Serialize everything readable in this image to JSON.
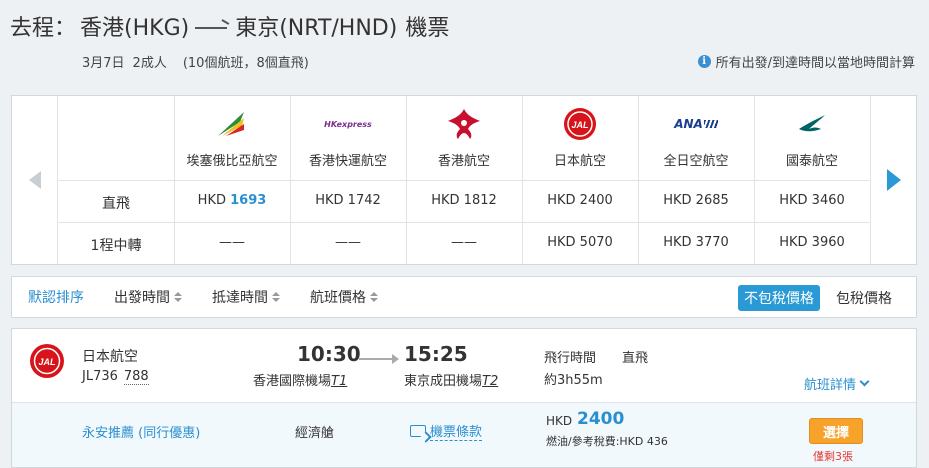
{
  "header": {
    "prefix": "去程",
    "colon": "：",
    "origin": "香港(HKG)",
    "destination": "東京(NRT/HND)",
    "suffix": "機票"
  },
  "subinfo": {
    "date": "3月7日",
    "passengers": "2成人",
    "summary": "(10個航班，8個直飛)"
  },
  "time_note": "所有出發/到達時間以當地時間計算",
  "matrix": {
    "row_labels": {
      "direct": "直飛",
      "one_stop": "1程中轉"
    },
    "airlines": [
      {
        "name": "埃塞俄比亞航空",
        "logo": "ethiopian-logo",
        "direct_cur": "HKD",
        "direct": "1693",
        "direct_highlight": true,
        "one_stop": "——"
      },
      {
        "name": "香港快運航空",
        "logo": "hkexpress-logo",
        "logo_text": "HKexpress",
        "direct_cur": "HKD",
        "direct": "1742",
        "one_stop": "——"
      },
      {
        "name": "香港航空",
        "logo": "hongkong-airlines-logo",
        "direct_cur": "HKD",
        "direct": "1812",
        "one_stop": "——"
      },
      {
        "name": "日本航空",
        "logo": "jal-logo",
        "logo_text": "JAL",
        "direct_cur": "HKD",
        "direct": "2400",
        "one_stop": "HKD 5070"
      },
      {
        "name": "全日空航空",
        "logo": "ana-logo",
        "logo_text": "ANA",
        "direct_cur": "HKD",
        "direct": "2685",
        "one_stop": "HKD 3770"
      },
      {
        "name": "國泰航空",
        "logo": "cathay-logo",
        "direct_cur": "HKD",
        "direct": "3460",
        "one_stop": "HKD 3960"
      }
    ]
  },
  "sortbar": {
    "items": [
      "默認排序",
      "出發時間",
      "抵達時間",
      "航班價格"
    ],
    "tax_exclusive": "不包稅價格",
    "tax_inclusive": "包稅價格"
  },
  "result": {
    "airline": "日本航空",
    "flight_code": "JL736",
    "flight_code2": "788",
    "dep_time": "10:30",
    "arr_time": "15:25",
    "dep_airport": "香港國際機場",
    "dep_terminal": "T1",
    "arr_airport": "東京成田機場",
    "arr_terminal": "T2",
    "flight_time_label": "飛行時間",
    "direct_label": "直飛",
    "duration": "約3h55m",
    "details_link": "航班詳情",
    "promo": "永安推薦 (同行優惠)",
    "cabin": "經濟艙",
    "terms": "機票條款",
    "price_currency": "HKD",
    "price": "2400",
    "tax_line": "燃油/參考稅費:HKD 436",
    "select": "選擇",
    "seats_left": "僅剩3張"
  },
  "colors": {
    "accent": "#2a9ad6",
    "select_button": "#f7a22a",
    "seats_warning": "#e53935"
  }
}
